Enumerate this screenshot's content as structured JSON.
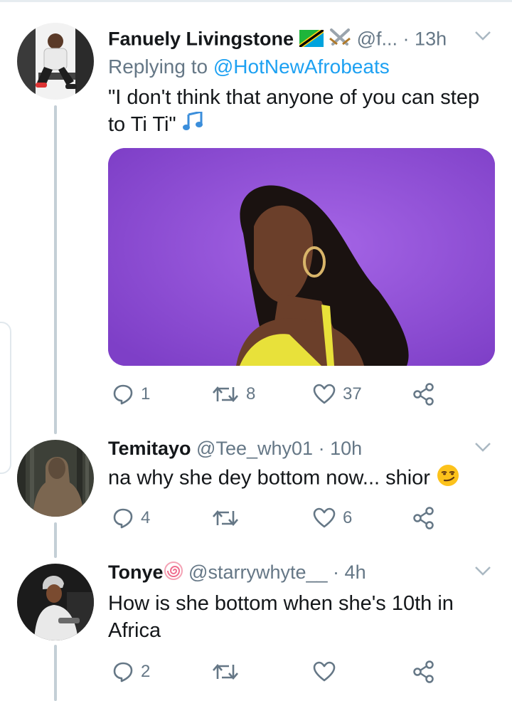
{
  "tweet1": {
    "name": "Fanuely Livingstone",
    "handle": "@f...",
    "separator": "·",
    "time": "13h",
    "replying_prefix": "Replying to",
    "replying_handle": "@HotNewAfrobeats",
    "text_line1": "\"I don't think that anyone of you can step",
    "text_line2": "to Ti Ti\"",
    "reply_count": "1",
    "retweet_count": "8",
    "like_count": "37"
  },
  "tweet2": {
    "name": "Temitayo",
    "handle": "@Tee_why01",
    "separator": "·",
    "time": "10h",
    "text": "na why she dey bottom now... shior",
    "reply_count": "4",
    "retweet_count": "",
    "like_count": "6"
  },
  "tweet3": {
    "name": "Tonye",
    "handle": "@starrywhyte__",
    "separator": "·",
    "time": "4h",
    "text_line1": "How is she bottom when she's 10th in",
    "text_line2": "Africa",
    "reply_count": "2",
    "retweet_count": "",
    "like_count": ""
  },
  "icons": {
    "reply": "reply-icon",
    "retweet": "retweet-icon",
    "like": "heart-icon",
    "share": "share-icon",
    "more": "chevron-down-icon"
  },
  "colors": {
    "link": "#1da1f2",
    "muted": "#657786",
    "media_background": "#8f4fd3"
  }
}
